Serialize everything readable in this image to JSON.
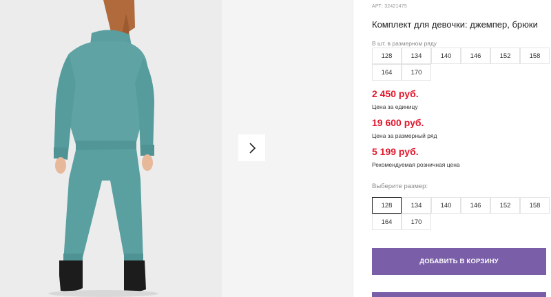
{
  "product": {
    "sku": "АРТ: 32421475",
    "title": "Комплект для девочки: джемпер, брюки",
    "range_label": "В шт. в размерном ряду"
  },
  "size_range": [
    "128",
    "134",
    "140",
    "146",
    "152",
    "158",
    "164",
    "170"
  ],
  "prices": [
    {
      "value": "2 450 руб.",
      "note": "Цена за единицу"
    },
    {
      "value": "19 600 руб.",
      "note": "Цена за размерный ряд"
    },
    {
      "value": "5 199 руб.",
      "note": "Рекомендуемая розничная цена"
    }
  ],
  "size_select": {
    "label": "Выберите размер:",
    "sizes": [
      "128",
      "134",
      "140",
      "146",
      "152",
      "158",
      "164",
      "170"
    ],
    "selected": "128"
  },
  "actions": {
    "add_to_cart": "ДОБАВИТЬ В КОРЗИНУ"
  },
  "colors": {
    "price": "#e0162b",
    "button": "#7a5fa8",
    "outfit": "#5fa3a4"
  },
  "icons": {
    "gallery_next": "chevron-right-icon"
  }
}
